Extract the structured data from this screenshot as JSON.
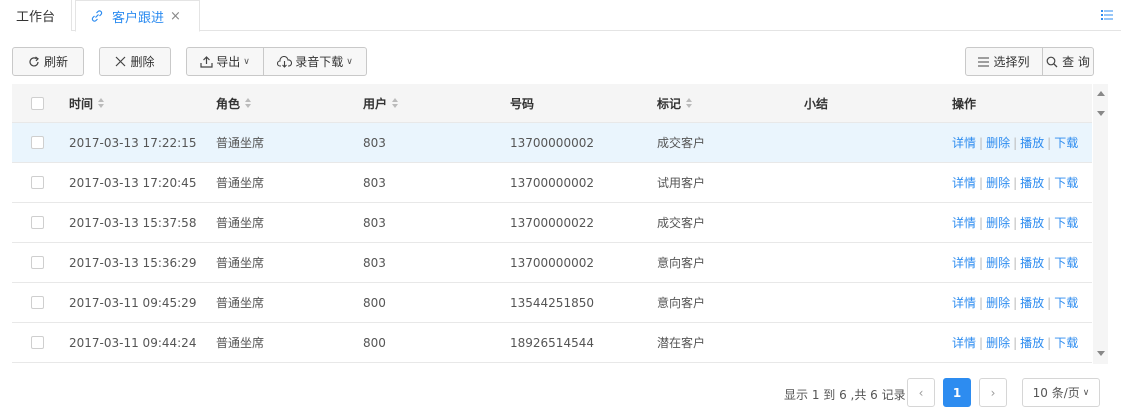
{
  "tabs": {
    "home": "工作台",
    "active": "客户跟进",
    "close": "×"
  },
  "toolbar": {
    "refresh": "刷新",
    "delete": "删除",
    "export": "导出",
    "download": "录音下载",
    "columns": "选择列",
    "query": "查 询"
  },
  "table": {
    "headers": {
      "time": "时间",
      "role": "角色",
      "user": "用户",
      "number": "号码",
      "tag": "标记",
      "summary": "小结",
      "ops": "操作"
    },
    "ops": {
      "detail": "详情",
      "delete": "删除",
      "play": "播放",
      "download": "下载",
      "sep": "|"
    },
    "rows": [
      {
        "time": "2017-03-13 17:22:15",
        "role": "普通坐席",
        "user": "803",
        "number": "13700000002",
        "tag": "成交客户",
        "summary": ""
      },
      {
        "time": "2017-03-13 17:20:45",
        "role": "普通坐席",
        "user": "803",
        "number": "13700000002",
        "tag": "试用客户",
        "summary": ""
      },
      {
        "time": "2017-03-13 15:37:58",
        "role": "普通坐席",
        "user": "803",
        "number": "13700000022",
        "tag": "成交客户",
        "summary": ""
      },
      {
        "time": "2017-03-13 15:36:29",
        "role": "普通坐席",
        "user": "803",
        "number": "13700000002",
        "tag": "意向客户",
        "summary": ""
      },
      {
        "time": "2017-03-11 09:45:29",
        "role": "普通坐席",
        "user": "800",
        "number": "13544251850",
        "tag": "意向客户",
        "summary": ""
      },
      {
        "time": "2017-03-11 09:44:24",
        "role": "普通坐席",
        "user": "800",
        "number": "18926514544",
        "tag": "潜在客户",
        "summary": ""
      }
    ]
  },
  "pagination": {
    "info": "显示 1 到 6 ,共 6 记录",
    "prev": "‹",
    "current": "1",
    "next": "›",
    "page_size": "10 条/页"
  },
  "colors": {
    "accent": "#2d8cf0",
    "selected_row": "#eaf5fd"
  }
}
